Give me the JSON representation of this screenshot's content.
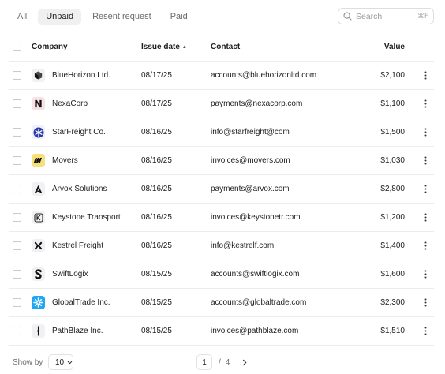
{
  "tabs": [
    {
      "label": "All",
      "active": false
    },
    {
      "label": "Unpaid",
      "active": true
    },
    {
      "label": "Resent request",
      "active": false
    },
    {
      "label": "Paid",
      "active": false
    }
  ],
  "search": {
    "placeholder": "Search",
    "shortcut": "⌘F"
  },
  "table": {
    "headers": {
      "company": "Company",
      "issue_date": "Issue date",
      "contact": "Contact",
      "value": "Value"
    },
    "rows": [
      {
        "company": "BlueHorizon Ltd.",
        "date": "08/17/25",
        "contact": "accounts@bluehorizonltd.com",
        "value": "$2,100",
        "logo": "cube-logo"
      },
      {
        "company": "NexaCorp",
        "date": "08/17/25",
        "contact": "payments@nexacorp.com",
        "value": "$1,100",
        "logo": "n-logo"
      },
      {
        "company": "StarFreight Co.",
        "date": "08/16/25",
        "contact": "info@starfreight@com",
        "value": "$1,500",
        "logo": "star-logo"
      },
      {
        "company": "Movers",
        "date": "08/16/25",
        "contact": "invoices@movers.com",
        "value": "$1,030",
        "logo": "movers-logo"
      },
      {
        "company": "Arvox Solutions",
        "date": "08/16/25",
        "contact": "payments@arvox.com",
        "value": "$2,800",
        "logo": "arvox-logo"
      },
      {
        "company": "Keystone Transport",
        "date": "08/16/25",
        "contact": "invoices@keystonetr.com",
        "value": "$1,200",
        "logo": "keystone-logo"
      },
      {
        "company": "Kestrel Freight",
        "date": "08/16/25",
        "contact": "info@kestrelf.com",
        "value": "$1,400",
        "logo": "kestrel-logo"
      },
      {
        "company": "SwiftLogix",
        "date": "08/15/25",
        "contact": "accounts@swiftlogix.com",
        "value": "$1,600",
        "logo": "swiftlogix-logo"
      },
      {
        "company": "GlobalTrade Inc.",
        "date": "08/15/25",
        "contact": "accounts@globaltrade.com",
        "value": "$2,300",
        "logo": "globaltrade-logo"
      },
      {
        "company": "PathBlaze Inc.",
        "date": "08/15/25",
        "contact": "invoices@pathblaze.com",
        "value": "$1,510",
        "logo": "pathblaze-logo"
      }
    ]
  },
  "footer": {
    "show_by_label": "Show by",
    "per_page": "10",
    "current_page": "1",
    "separator": "/",
    "total_pages": "4"
  },
  "colors": {
    "accent_cyan": "#1ea7f5",
    "star_blue": "#2b3aa8",
    "movers_yellow": "#f5e17a",
    "nexa_pink": "#f8e1e7"
  }
}
